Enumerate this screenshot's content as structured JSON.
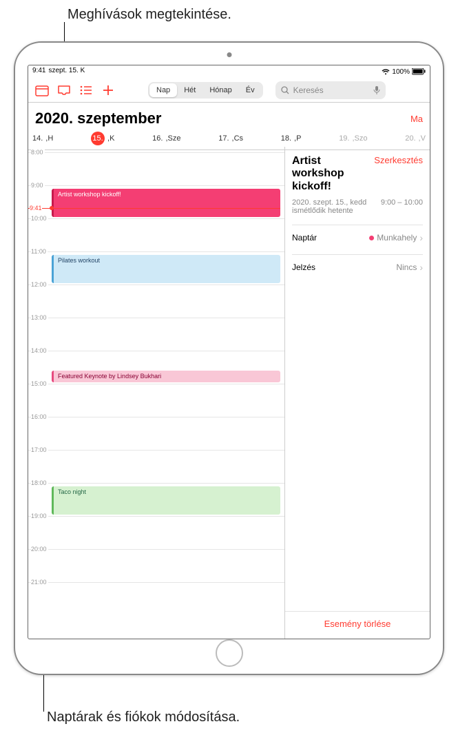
{
  "callouts": {
    "top": "Meghívások megtekintése.",
    "bottom": "Naptárak és fiókok módosítása."
  },
  "status": {
    "time": "9:41",
    "date": "szept. 15. K",
    "battery_pct": "100%"
  },
  "toolbar": {
    "icons": {
      "calendars": "calendars-icon",
      "inbox": "inbox-icon",
      "list": "list-icon",
      "add": "add-icon"
    },
    "segments": [
      "Nap",
      "Hét",
      "Hónap",
      "Év"
    ],
    "active_segment": "Nap",
    "search_placeholder": "Keresés"
  },
  "header": {
    "month_title": "2020. szeptember",
    "today": "Ma"
  },
  "week": [
    {
      "num": "14.",
      "dow": ",H",
      "weekend": false,
      "selected": false
    },
    {
      "num": "15.",
      "dow": ",K",
      "weekend": false,
      "selected": true
    },
    {
      "num": "16.",
      "dow": ",Sze",
      "weekend": false,
      "selected": false
    },
    {
      "num": "17.",
      "dow": ",Cs",
      "weekend": false,
      "selected": false
    },
    {
      "num": "18.",
      "dow": ",P",
      "weekend": false,
      "selected": false
    },
    {
      "num": "19.",
      "dow": ",Szo",
      "weekend": true,
      "selected": false
    },
    {
      "num": "20.",
      "dow": ",V",
      "weekend": true,
      "selected": false
    }
  ],
  "hours": [
    "8:00",
    "9:00",
    "10:00",
    "11:00",
    "12:00",
    "13:00",
    "14:00",
    "15:00",
    "16:00",
    "17:00",
    "18:00",
    "19:00",
    "20:00",
    "21:00"
  ],
  "now_label": "9:41",
  "events": [
    {
      "title": "Artist workshop kickoff!",
      "start_h": 9.1,
      "end_h": 10.0,
      "class": "ev-pink"
    },
    {
      "title": "Pilates workout",
      "start_h": 11.1,
      "end_h": 12.0,
      "class": "ev-blue"
    },
    {
      "title": "Featured Keynote by Lindsey Bukhari",
      "start_h": 14.6,
      "end_h": 15.0,
      "class": "ev-rose"
    },
    {
      "title": "Taco night",
      "start_h": 18.1,
      "end_h": 19.0,
      "class": "ev-green"
    }
  ],
  "detail": {
    "title": "Artist workshop kickoff!",
    "edit": "Szerkesztés",
    "date_line": "2020. szept. 15., kedd",
    "time_range": "9:00 – 10:00",
    "recur": "ismétlődik hetente",
    "rows": [
      {
        "label": "Naptár",
        "value": "Munkahely",
        "dot": true,
        "chevron": true
      },
      {
        "label": "Jelzés",
        "value": "Nincs",
        "dot": false,
        "chevron": true
      }
    ],
    "delete": "Esemény törlése"
  }
}
